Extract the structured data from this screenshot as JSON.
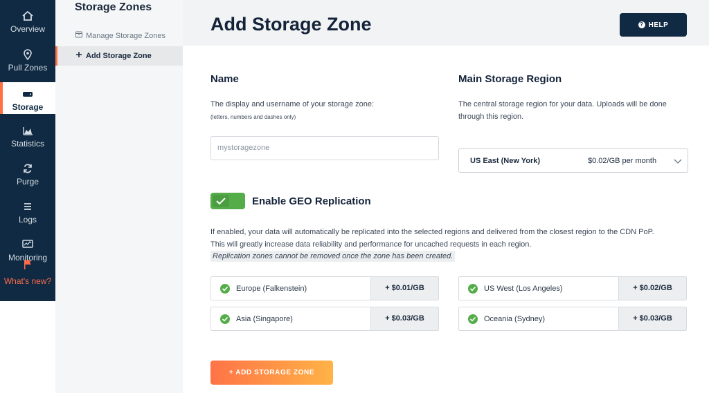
{
  "nav": {
    "items": [
      {
        "label": "Overview",
        "icon": "home-icon"
      },
      {
        "label": "Pull Zones",
        "icon": "location-pin-icon"
      },
      {
        "label": "Storage",
        "icon": "hard-drive-icon"
      },
      {
        "label": "Statistics",
        "icon": "area-chart-icon"
      },
      {
        "label": "Purge",
        "icon": "refresh-icon"
      },
      {
        "label": "Logs",
        "icon": "list-icon"
      },
      {
        "label": "Monitoring",
        "icon": "monitor-icon"
      }
    ],
    "whats_new": "What's new?"
  },
  "subnav": {
    "title": "Storage Zones",
    "items": [
      {
        "label": "Manage Storage Zones"
      },
      {
        "label": "Add Storage Zone"
      }
    ]
  },
  "header": {
    "title": "Add Storage Zone",
    "help_label": "HELP"
  },
  "name_section": {
    "heading": "Name",
    "desc": "The display and username of your storage zone:",
    "hint": "(letters, numbers and dashes only)",
    "placeholder": "mystoragezone"
  },
  "region_section": {
    "heading": "Main Storage Region",
    "desc_line1": "The central storage region for your data. Uploads will be done",
    "desc_line2": "through this region.",
    "selected_region": "US East (New York)",
    "selected_price": "$0.02/GB per month"
  },
  "geo": {
    "label": "Enable GEO Replication",
    "enabled": true,
    "desc_line1": "If enabled, your data will automatically be replicated into the selected regions and delivered from the closest region to the CDN PoP.",
    "desc_line2": "This will greatly increase data reliability and performance for uncached requests in each region.",
    "note": "Replication zones cannot be removed once the zone has been created.",
    "zones": [
      {
        "name": "Europe (Falkenstein)",
        "price": "+ $0.01/GB"
      },
      {
        "name": "US West (Los Angeles)",
        "price": "+ $0.02/GB"
      },
      {
        "name": "Asia (Singapore)",
        "price": "+ $0.03/GB"
      },
      {
        "name": "Oceania (Sydney)",
        "price": "+ $0.03/GB"
      }
    ]
  },
  "actions": {
    "add_label": "+ ADD STORAGE ZONE"
  },
  "colors": {
    "nav_bg": "#0f2a42",
    "accent": "#ff7043",
    "success": "#55ad4a"
  }
}
